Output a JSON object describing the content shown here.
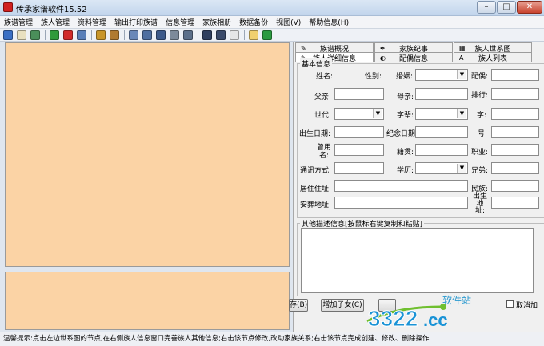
{
  "window": {
    "title": "传承家谱软件15.52",
    "controls": {
      "minimize": "–",
      "maximize": "□",
      "close": "✕"
    }
  },
  "menu": [
    "族谱管理",
    "族人管理",
    "资料管理",
    "输出打印族谱",
    "信息管理",
    "家族相册",
    "数据备份",
    "视图(V)",
    "帮助信息(H)"
  ],
  "toolbar": {
    "icons": [
      {
        "name": "tree-view-icon",
        "color": "#3a6fc4"
      },
      {
        "name": "book-icon",
        "color": "#e8e0c0"
      },
      {
        "name": "photo-icon",
        "color": "#4a8f5a"
      },
      {
        "sep": true
      },
      {
        "name": "add-person-icon",
        "color": "#2f9a3a"
      },
      {
        "name": "delete-icon",
        "color": "#d12a2a"
      },
      {
        "name": "edit-card-icon",
        "color": "#5a7fb8"
      },
      {
        "sep": true
      },
      {
        "name": "people-icon",
        "color": "#c9962a"
      },
      {
        "name": "family-icon",
        "color": "#b07a30"
      },
      {
        "sep": true
      },
      {
        "name": "print-icon",
        "color": "#6a88b8"
      },
      {
        "name": "chart-icon",
        "color": "#4f6fa0"
      },
      {
        "name": "building-icon",
        "color": "#3d5a8a"
      },
      {
        "name": "settings-icon",
        "color": "#7c8a9a"
      },
      {
        "name": "network-icon",
        "color": "#5b6f8a"
      },
      {
        "sep": true
      },
      {
        "name": "open-book-icon",
        "color": "#2e3e5e"
      },
      {
        "name": "books-icon",
        "color": "#3a4a6a"
      },
      {
        "name": "text-icon",
        "color": "#e6e6e6"
      },
      {
        "sep": true
      },
      {
        "name": "chat-icon",
        "color": "#f0d070"
      },
      {
        "name": "exit-icon",
        "color": "#2a9a40"
      }
    ]
  },
  "tabs_back": [
    "族谱概况",
    "家族纪事",
    "族人世系图"
  ],
  "tabs_front": [
    "族人详细信息",
    "配偶信息",
    "族人列表"
  ],
  "form": {
    "group_title": "基本信息",
    "labels": {
      "name": "姓名:",
      "gender": "性别:",
      "marriage": "婚姻:",
      "spouse": "配偶:",
      "father": "父亲:",
      "mother": "母亲:",
      "rank": "排行:",
      "generation": "世代:",
      "generation_char": "字辈:",
      "courtesy_name": "字:",
      "birth_date": "出生日期:",
      "memorial_date": "纪念日期:",
      "hao": "号:",
      "former_name": "曾用名:",
      "native_place": "籍贯:",
      "occupation": "职业:",
      "contact": "通讯方式:",
      "education": "学历:",
      "brothers": "兄弟:",
      "residence": "居住住址:",
      "ethnicity": "民族:",
      "burial": "安葬地址:",
      "birthplace": "出生地址:"
    },
    "values": {
      "name": "",
      "gender": "",
      "marriage": "",
      "spouse": "",
      "father": "",
      "mother": "",
      "rank": "",
      "generation": "",
      "generation_char": "",
      "courtesy_name": "",
      "birth_date": "",
      "memorial_date": "",
      "hao": "",
      "former_name": "",
      "native_place": "",
      "occupation": "",
      "contact": "",
      "education": "",
      "brothers": "",
      "residence": "",
      "ethnicity": "",
      "burial": "",
      "birthplace": ""
    },
    "other_info_title": "其他描述信息[按鼠标右键复制和粘贴]",
    "other_info": ""
  },
  "buttons": {
    "save_partial": "存(B)",
    "add_child": "增加子女(C)",
    "cancel_add_checkbox": "取消加"
  },
  "status": "温馨提示:点击左边世系图的节点,在右侧族人信息窗口完善族人其他信息;右击该节点修改,改动家族关系;右击该节点完成创建、修改、删除操作",
  "watermark": {
    "number": "3322",
    "domain": ".cc",
    "cn": "软件站"
  }
}
